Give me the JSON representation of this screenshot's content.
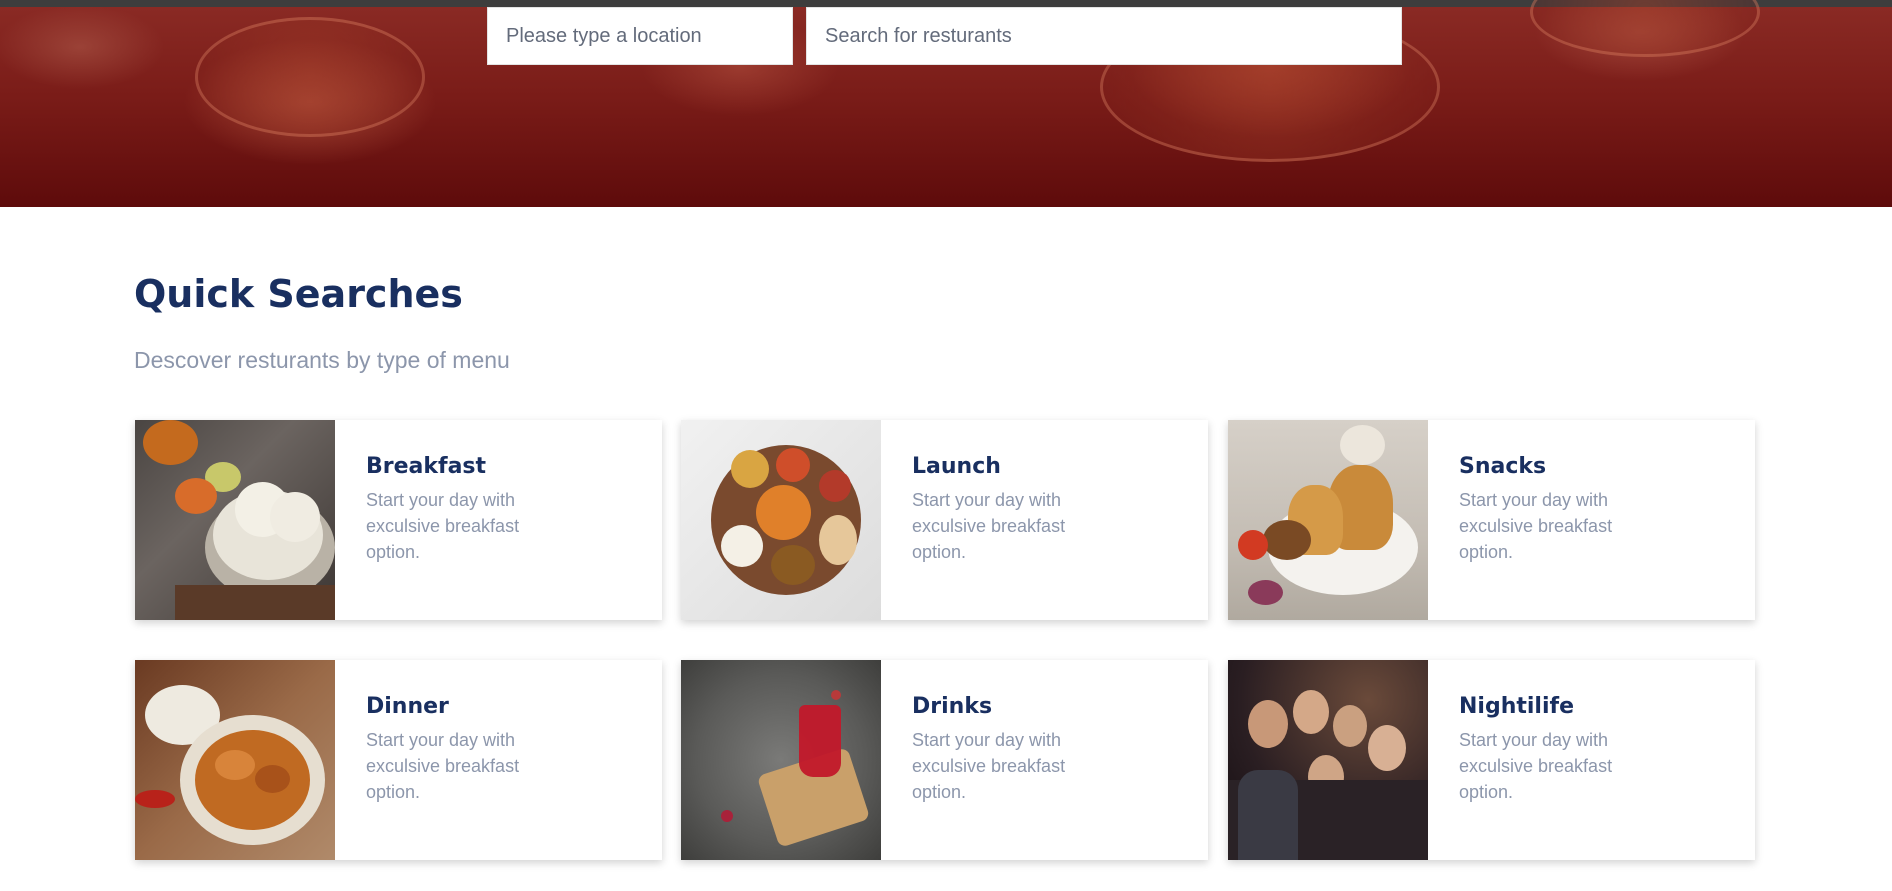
{
  "search": {
    "location_placeholder": "Please type a location",
    "restaurant_placeholder": "Search for resturants"
  },
  "quick_searches": {
    "title": "Quick Searches",
    "subtitle": "Descover resturants by type of menu",
    "cards": [
      {
        "title": "Breakfast",
        "description": "Start your day with exculsive breakfast option.",
        "image": "idli-breakfast-photo"
      },
      {
        "title": "Launch",
        "description": "Start your day with exculsive breakfast option.",
        "image": "thali-lunch-photo"
      },
      {
        "title": "Snacks",
        "description": "Start your day with exculsive breakfast option.",
        "image": "samosa-snacks-photo"
      },
      {
        "title": "Dinner",
        "description": "Start your day with exculsive breakfast option.",
        "image": "curry-dinner-photo"
      },
      {
        "title": "Drinks",
        "description": "Start your day with exculsive breakfast option.",
        "image": "red-drink-photo"
      },
      {
        "title": "Nightilife",
        "description": "Start your day with exculsive breakfast option.",
        "image": "party-nightlife-photo"
      }
    ]
  },
  "colors": {
    "hero_red": "#6e1412",
    "heading_navy": "#192f60",
    "muted_text": "#8c96ab"
  }
}
